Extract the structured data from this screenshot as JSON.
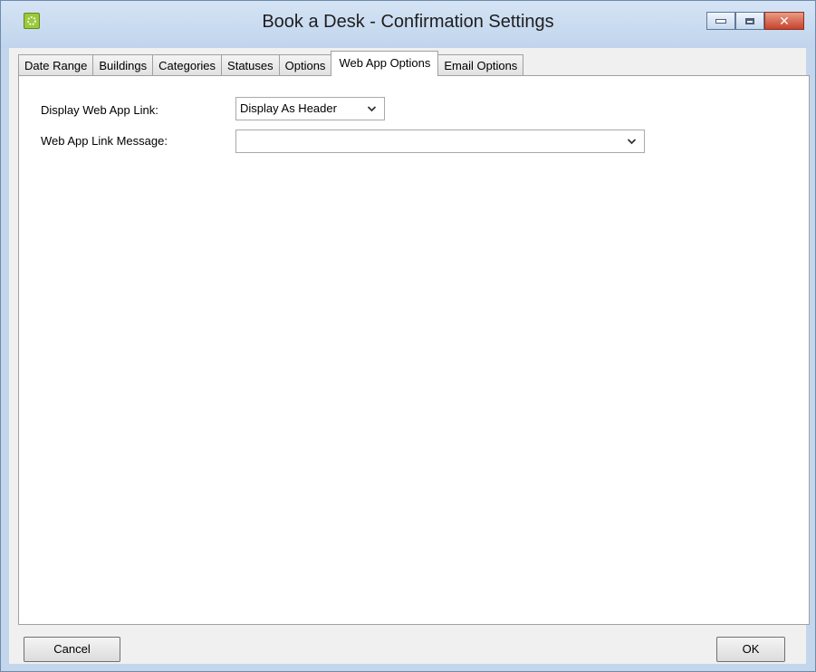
{
  "window": {
    "title": "Book a Desk - Confirmation Settings",
    "close_glyph": "✕"
  },
  "tabs": [
    {
      "label": "Date Range"
    },
    {
      "label": "Buildings"
    },
    {
      "label": "Categories"
    },
    {
      "label": "Statuses"
    },
    {
      "label": "Options"
    },
    {
      "label": "Web App Options",
      "active": true
    },
    {
      "label": "Email Options"
    }
  ],
  "form": {
    "display_link_label": "Display Web App Link:",
    "display_link_value": "Display As Header",
    "link_message_label": "Web App Link Message:",
    "link_message_value": ""
  },
  "footer": {
    "cancel_label": "Cancel",
    "ok_label": "OK"
  },
  "icons": {
    "app": "app-logo-icon",
    "dropdown": "chevron-down-icon"
  },
  "colors": {
    "titlebar": "#c8daef",
    "close_button": "#c7432d",
    "client_bg": "#f0f0f0"
  }
}
